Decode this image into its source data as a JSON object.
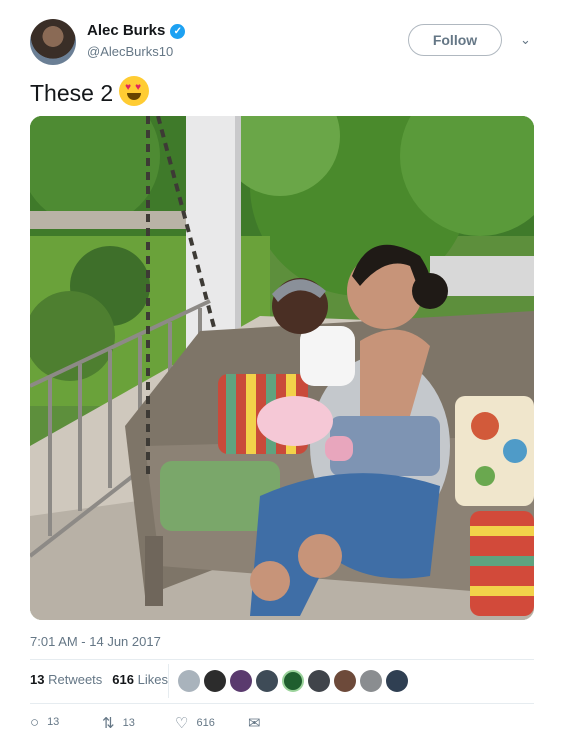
{
  "author": {
    "name": "Alec Burks",
    "handle": "@AlecBurks10",
    "verified_glyph": "✓",
    "avatar_icon": "profile-photo"
  },
  "follow_label": "Follow",
  "menu_glyph": "⌄",
  "tweet_text": "These 2",
  "emoji": {
    "eye": "♥",
    "name": "heart-eyes-emoji"
  },
  "timestamp": "7:01 AM - 14 Jun 2017",
  "stats": {
    "retweets_count": "13",
    "retweets_label": "Retweets",
    "likes_count": "616",
    "likes_label": "Likes"
  },
  "actions": {
    "reply_icon": "○",
    "reply_count": "13",
    "retweet_icon": "⇅",
    "retweet_count": "13",
    "like_icon": "♡",
    "like_count": "616",
    "dm_icon": "✉"
  },
  "colors": {
    "text": "#14171a",
    "secondary": "#657786",
    "verified": "#1da1f2",
    "divider": "#e6ecf0"
  }
}
